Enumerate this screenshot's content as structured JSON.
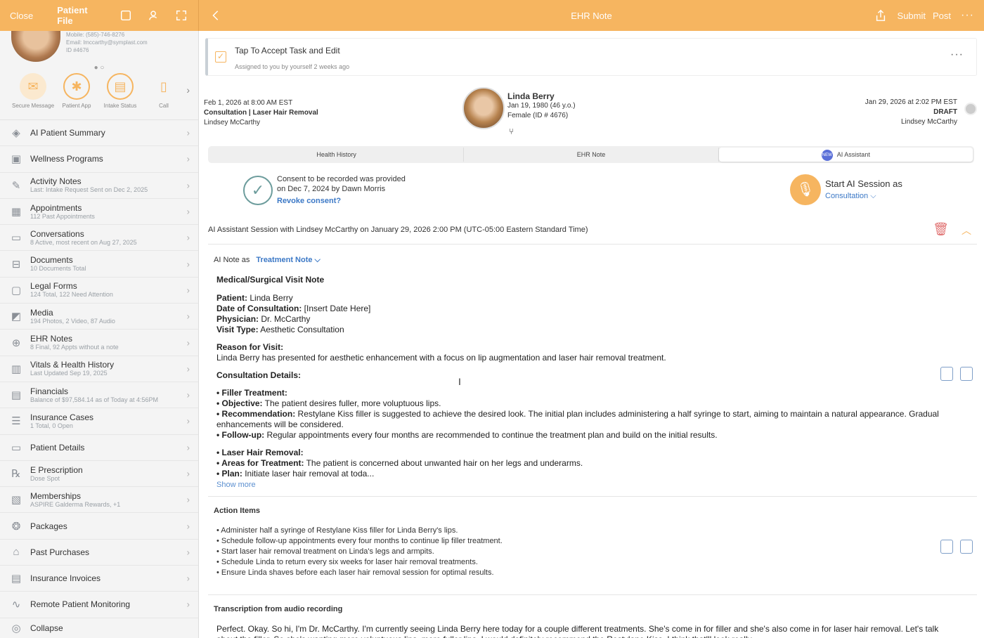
{
  "topbar_left": {
    "close": "Close",
    "patient_file": "Patient File"
  },
  "topbar_right": {
    "title": "EHR Note",
    "submit": "Submit",
    "post": "Post"
  },
  "profile": {
    "mobile": "Mobile: (585)-746-8276",
    "email": "Email: lmccarthy@symplast.com",
    "id": "ID #4676"
  },
  "quick_actions": [
    {
      "label": "Secure Message",
      "icon": "chat-bubble-icon"
    },
    {
      "label": "Patient App",
      "icon": "app-icon"
    },
    {
      "label": "Intake Status",
      "icon": "clipboard-icon"
    },
    {
      "label": "Call",
      "icon": "phone-icon"
    }
  ],
  "menu": [
    {
      "label": "AI Patient Summary",
      "sub": ""
    },
    {
      "label": "Wellness Programs",
      "sub": ""
    },
    {
      "label": "Activity Notes",
      "sub": "Last: Intake Request Sent on Dec 2, 2025"
    },
    {
      "label": "Appointments",
      "sub": "112 Past Appointments"
    },
    {
      "label": "Conversations",
      "sub": "8 Active, most recent on Aug 27, 2025"
    },
    {
      "label": "Documents",
      "sub": "10 Documents Total"
    },
    {
      "label": "Legal Forms",
      "sub": "124 Total, 122 Need Attention"
    },
    {
      "label": "Media",
      "sub": "194 Photos, 2 Video, 87 Audio"
    },
    {
      "label": "EHR Notes",
      "sub": "8 Final, 92 Appts without a note"
    },
    {
      "label": "Vitals & Health History",
      "sub": "Last Updated Sep 19, 2025"
    },
    {
      "label": "Financials",
      "sub": "Balance of $97,584.14 as of Today at 4:56PM"
    },
    {
      "label": "Insurance Cases",
      "sub": "1 Total, 0 Open"
    },
    {
      "label": "Patient Details",
      "sub": ""
    },
    {
      "label": "E Prescription",
      "sub": "Dose Spot"
    },
    {
      "label": "Memberships",
      "sub": "ASPIRE Galderma Rewards, +1"
    },
    {
      "label": "Packages",
      "sub": ""
    },
    {
      "label": "Past Purchases",
      "sub": ""
    },
    {
      "label": "Insurance Invoices",
      "sub": ""
    },
    {
      "label": "Remote Patient Monitoring",
      "sub": ""
    }
  ],
  "collapse": "Collapse",
  "task": {
    "title": "Tap To Accept Task and Edit",
    "assigned": "Assigned to you by yourself 2 weeks ago"
  },
  "appointment": {
    "date": "Feb 1, 2026 at 8:00 AM EST",
    "type": "Consultation | Laser Hair Removal",
    "provider": "Lindsey McCarthy"
  },
  "patient": {
    "name": "Linda Berry",
    "dob": "Jan 19, 1980 (46 y.o.)",
    "sex_id": "Female (ID # 4676)"
  },
  "note_meta": {
    "date": "Jan 29, 2026 at 2:02 PM EST",
    "status": "DRAFT",
    "provider": "Lindsey McCarthy"
  },
  "tabs": {
    "health_history": "Health History",
    "ehr_note": "EHR Note",
    "ai_assistant": "AI Assistant",
    "new_badge": "NEW"
  },
  "consent": {
    "line1": "Consent to be recorded was provided",
    "line2": "on Dec 7, 2024 by Dawn Morris",
    "revoke": "Revoke consent?"
  },
  "ai_session_start": {
    "label": "Start AI Session as",
    "option": "Consultation"
  },
  "session_title": "AI Assistant Session with Lindsey McCarthy on January 29, 2026 2:00 PM (UTC-05:00 Eastern Standard Time)",
  "ai_note": {
    "label": "AI Note as",
    "type": "Treatment Note"
  },
  "note": {
    "heading": "Medical/Surgical Visit Note",
    "patient_label": "Patient:",
    "patient_value": " Linda Berry",
    "date_label": "Date of Consultation:",
    "date_value": " [Insert Date Here]",
    "physician_label": "Physician:",
    "physician_value": " Dr. McCarthy",
    "visit_label": "Visit Type:",
    "visit_value": " Aesthetic Consultation",
    "reason_label": "Reason for Visit:",
    "reason_text": "Linda Berry has presented for aesthetic enhancement with a focus on lip augmentation and laser hair removal treatment.",
    "details_label": "Consultation Details:",
    "filler_label": "• Filler Treatment:",
    "objective_label": "• Objective:",
    "objective_text": " The patient desires fuller, more voluptuous lips.",
    "recommendation_label": "• Recommendation:",
    "recommendation_text": " Restylane Kiss filler is suggested to achieve the desired look. The initial plan includes administering a half syringe to start, aiming to maintain a natural appearance. Gradual enhancements will be considered.",
    "followup_label": "• Follow-up:",
    "followup_text": " Regular appointments every four months are recommended to continue the treatment plan and build on the initial results.",
    "laser_label": "• Laser Hair Removal:",
    "areas_label": "• Areas for Treatment:",
    "areas_text": " The patient is concerned about unwanted hair on her legs and underarms.",
    "plan_label": "• Plan:",
    "plan_text": " Initiate laser hair removal at toda...",
    "show_more": "Show more"
  },
  "action_items_title": "Action Items",
  "action_items": [
    "• Administer half a syringe of Restylane Kiss filler for Linda Berry's lips.",
    "• Schedule follow-up appointments every four months to continue lip filler treatment.",
    "• Start laser hair removal treatment on Linda's legs and armpits.",
    "• Schedule Linda to return every six weeks for laser hair removal treatments.",
    "• Ensure Linda shaves before each laser hair removal session for optimal results."
  ],
  "transcription_title": "Transcription from audio recording",
  "transcription_text": "Perfect. Okay. So hi, I'm Dr. McCarthy. I'm currently seeing Linda Berry here today for a couple different treatments. She's come in for filler and she's also come in for laser hair removal. Let's talk about the filler. So she's wanting more voluptuous lips, more fuller lips. I would definitely recommend the Restylane Kiss. I think that'll look really"
}
